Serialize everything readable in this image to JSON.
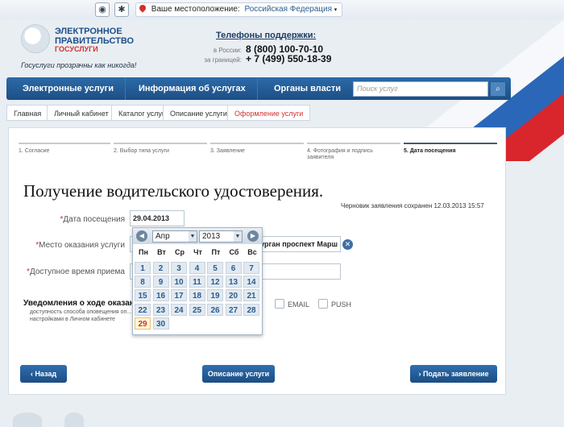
{
  "topbar": {
    "icons": [
      "eye-icon",
      "compass-icon"
    ],
    "location_label": "Ваше местоположение:",
    "location_value": "Российская Федерация"
  },
  "logo": {
    "line1": "ЭЛЕКТРОННОЕ",
    "line2": "ПРАВИТЕЛЬСТВО",
    "line3": "ГОСУСЛУГИ",
    "tagline": "Госуслуги прозрачны как никогда!"
  },
  "support": {
    "title": "Телефоны поддержки:",
    "russia_label": "в России:",
    "russia_number": "8 (800) 100-70-10",
    "abroad_label": "за границей:",
    "abroad_number": "+ 7 (499) 550-18-39"
  },
  "nav": {
    "items": [
      "Электронные услуги",
      "Информация об услугах",
      "Органы власти"
    ],
    "search_placeholder": "Поиск услуг"
  },
  "breadcrumb": [
    "Главная",
    "Личный кабинет",
    "Каталог услуг",
    "Описание услуги",
    "Оформление услуги"
  ],
  "steps": [
    "1. Согласие",
    "2. Выбор типа услуги",
    "3. Заявление",
    "4. Фотография и подпись заявителя",
    "5. Дата посещения"
  ],
  "active_step": 5,
  "page_title": "Получение водительского удостоверения.",
  "draft_note": "Черновик заявления сохранен 12.03.2013 15:57",
  "form": {
    "visit_date_label": "Дата посещения",
    "visit_date_value": "29.04.2013",
    "service_place_label": "Место оказания услуги",
    "service_place_value": "Курган проспект Марш",
    "time_label": "Доступное время приема",
    "notifications_title": "Уведомления о ходе оказания",
    "notifications_desc": "доступность способа оповещения оп... настройками в Личном кабинете",
    "email_label": "EMAIL",
    "push_label": "PUSH"
  },
  "calendar": {
    "month": "Апр",
    "year": "2013",
    "weekdays": [
      "Пн",
      "Вт",
      "Ср",
      "Чт",
      "Пт",
      "Сб",
      "Вс"
    ],
    "weeks": [
      [
        "1",
        "2",
        "3",
        "4",
        "5",
        "6",
        "7"
      ],
      [
        "8",
        "9",
        "10",
        "11",
        "12",
        "13",
        "14"
      ],
      [
        "15",
        "16",
        "17",
        "18",
        "19",
        "20",
        "21"
      ],
      [
        "22",
        "23",
        "24",
        "25",
        "26",
        "27",
        "28"
      ],
      [
        "29",
        "30",
        "",
        "",
        "",
        "",
        ""
      ]
    ],
    "selected_day": "29"
  },
  "buttons": {
    "back": "Назад",
    "service_desc": "Описание услуги",
    "submit": "Подать заявление"
  },
  "colors": {
    "brand_blue": "#1d4f86",
    "accent_red": "#d0312d"
  }
}
